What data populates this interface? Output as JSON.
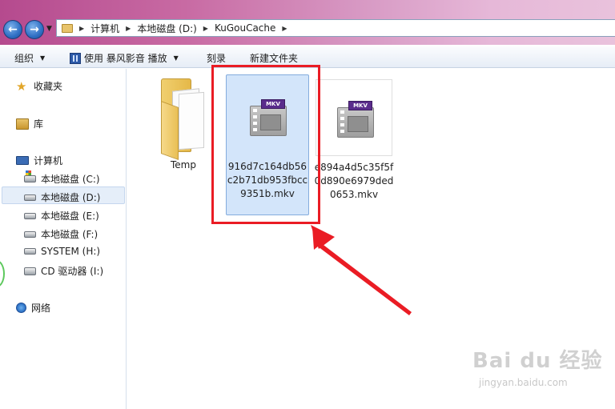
{
  "nav": {
    "back_icon": "back-arrow-icon",
    "forward_icon": "forward-arrow-icon",
    "breadcrumb": [
      "计算机",
      "本地磁盘 (D:)",
      "KuGouCache"
    ]
  },
  "toolbar": {
    "organize": "组织",
    "play_with": "使用 暴风影音 播放",
    "burn": "刻录",
    "new_folder": "新建文件夹"
  },
  "sidebar": {
    "favorites": "收藏夹",
    "libraries": "库",
    "computer": "计算机",
    "drives": [
      "本地磁盘 (C:)",
      "本地磁盘 (D:)",
      "本地磁盘 (E:)",
      "本地磁盘 (F:)",
      "SYSTEM (H:)",
      "CD 驱动器 (I:)"
    ],
    "network": "网络",
    "selected": "本地磁盘 (D:)"
  },
  "files": [
    {
      "name": "Temp",
      "type": "folder"
    },
    {
      "name": "916d7c164db56c2b71db953fbcc9351b.mkv",
      "type": "mkv",
      "badge": "MKV",
      "selected": true
    },
    {
      "name": "e894a4d5c35f5f0d890e6979ded0653.mkv",
      "type": "mkv",
      "badge": "MKV"
    }
  ],
  "watermark": {
    "logo": "Bai du 经验",
    "url": "jingyan.baidu.com"
  },
  "colors": {
    "title_gradient_start": "#b54a8e",
    "selection": "#d3e5fa",
    "annotation_red": "#ea1c24"
  }
}
